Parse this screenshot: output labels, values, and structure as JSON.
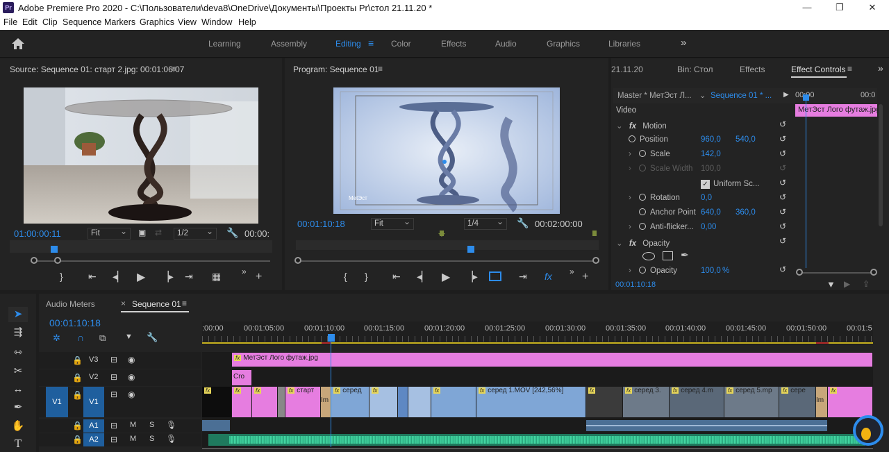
{
  "titlebar": {
    "app_icon": "Pr",
    "title": "Adobe Premiere Pro 2020 - C:\\Пользователи\\deva8\\OneDrive\\Документы\\Проекты Pr\\стол 21.11.20  *",
    "minimize": "—",
    "maximize": "❐",
    "close": "✕"
  },
  "menu": [
    "File",
    "Edit",
    "Clip",
    "Sequence",
    "Markers",
    "Graphics",
    "View",
    "Window",
    "Help"
  ],
  "workspaces": {
    "items": [
      "Learning",
      "Assembly",
      "Editing",
      "Color",
      "Effects",
      "Audio",
      "Graphics",
      "Libraries"
    ],
    "active": "Editing",
    "home_icon": "home-icon",
    "more": "»"
  },
  "source": {
    "header": "Source: Sequence 01: старт 2.jpg: 00:01:06:07",
    "timecode": "01:00:00:11",
    "fit": "Fit",
    "resolution": "1/2",
    "duration": "00:00:"
  },
  "program": {
    "header": "Program: Sequence 01",
    "timecode": "00:01:10:18",
    "fit": "Fit",
    "resolution": "1/4",
    "duration": "00:02:00:00",
    "watermark": "MetЭст"
  },
  "right_panel": {
    "tabs": [
      "21.11.20",
      "Bin: Стол",
      "Effects",
      "Effect Controls"
    ],
    "active_tab": "Effect Controls",
    "master": "Master * МетЭст Л...",
    "sequence": "Sequence 01 * ...",
    "mini_time_start": "00:00",
    "mini_time_end": "00:0",
    "clip_label": "МетЭст Лого футаж.jpg",
    "video_label": "Video",
    "motion_label": "Motion",
    "opacity_section": "Opacity",
    "properties": [
      {
        "name": "Position",
        "v1": "960,0",
        "v2": "540,0"
      },
      {
        "name": "Scale",
        "v1": "142,0",
        "v2": ""
      },
      {
        "name": "Scale Width",
        "v1": "100,0",
        "v2": ""
      },
      {
        "name": "Uniform Sc...",
        "v1": "",
        "v2": ""
      },
      {
        "name": "Rotation",
        "v1": "0,0",
        "v2": ""
      },
      {
        "name": "Anchor Point",
        "v1": "640,0",
        "v2": "360,0"
      },
      {
        "name": "Anti-flicker...",
        "v1": "0,00",
        "v2": ""
      },
      {
        "name": "Opacity",
        "v1": "100,0",
        "v2": "%"
      }
    ],
    "timecode": "00:01:10:18"
  },
  "timeline": {
    "tabs": [
      "Audio Meters",
      "Sequence 01"
    ],
    "active_tab": "Sequence 01",
    "timecode": "00:01:10:18",
    "ruler": [
      ":00:00",
      "00:01:05:00",
      "00:01:10:00",
      "00:01:15:00",
      "00:01:20:00",
      "00:01:25:00",
      "00:01:30:00",
      "00:01:35:00",
      "00:01:40:00",
      "00:01:45:00",
      "00:01:50:00",
      "00:01:5"
    ],
    "tracks": {
      "v3": "V3",
      "v2": "V2",
      "v1": "V1",
      "v1_src": "V1",
      "a1": "A1",
      "a2": "A2",
      "m": "M",
      "s": "S"
    },
    "clips": {
      "v3_logo": "МетЭст Лого футаж.jpg",
      "v2_cro": "Cro",
      "v1_start": "старт",
      "v1_sered": "серед",
      "v1_sered1": "серед 1.MOV [242,56%]",
      "v1_sered3": "серед 3.",
      "v1_sered4": "серед 4.m",
      "v1_sered5": "серед 5.mp",
      "v1_sere": "сере",
      "v1_im": "Im"
    }
  },
  "colors": {
    "accent": "#2d8ceb",
    "clip_pink": "#e67de0",
    "clip_blue": "#7fa6d6",
    "audio_green": "#2aa57d",
    "panel_bg": "#232323"
  }
}
